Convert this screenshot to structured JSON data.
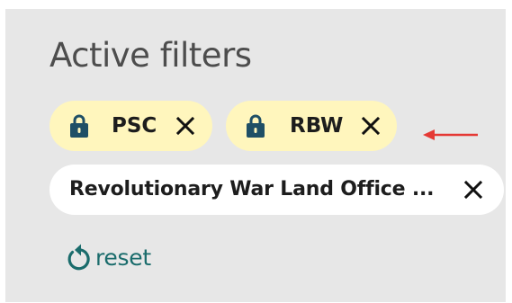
{
  "filters_panel": {
    "heading": "Active filters",
    "locked_filters": [
      {
        "label": "PSC",
        "icon": "lock-icon",
        "remove_icon": "close-icon"
      },
      {
        "label": "RBW",
        "icon": "lock-icon",
        "remove_icon": "close-icon"
      }
    ],
    "filters": [
      {
        "label": "Revolutionary War Land Office ...",
        "remove_icon": "close-icon"
      }
    ],
    "reset": {
      "label": "reset",
      "icon": "reset-icon"
    },
    "annotation": {
      "icon": "arrow-left-icon",
      "color": "#e53935"
    }
  },
  "colors": {
    "panel_background": "#e7e7e7",
    "locked_chip": "#fff6bd",
    "chip": "#ffffff",
    "lock_icon": "#1f4f66",
    "accent": "#1a6c6c"
  }
}
